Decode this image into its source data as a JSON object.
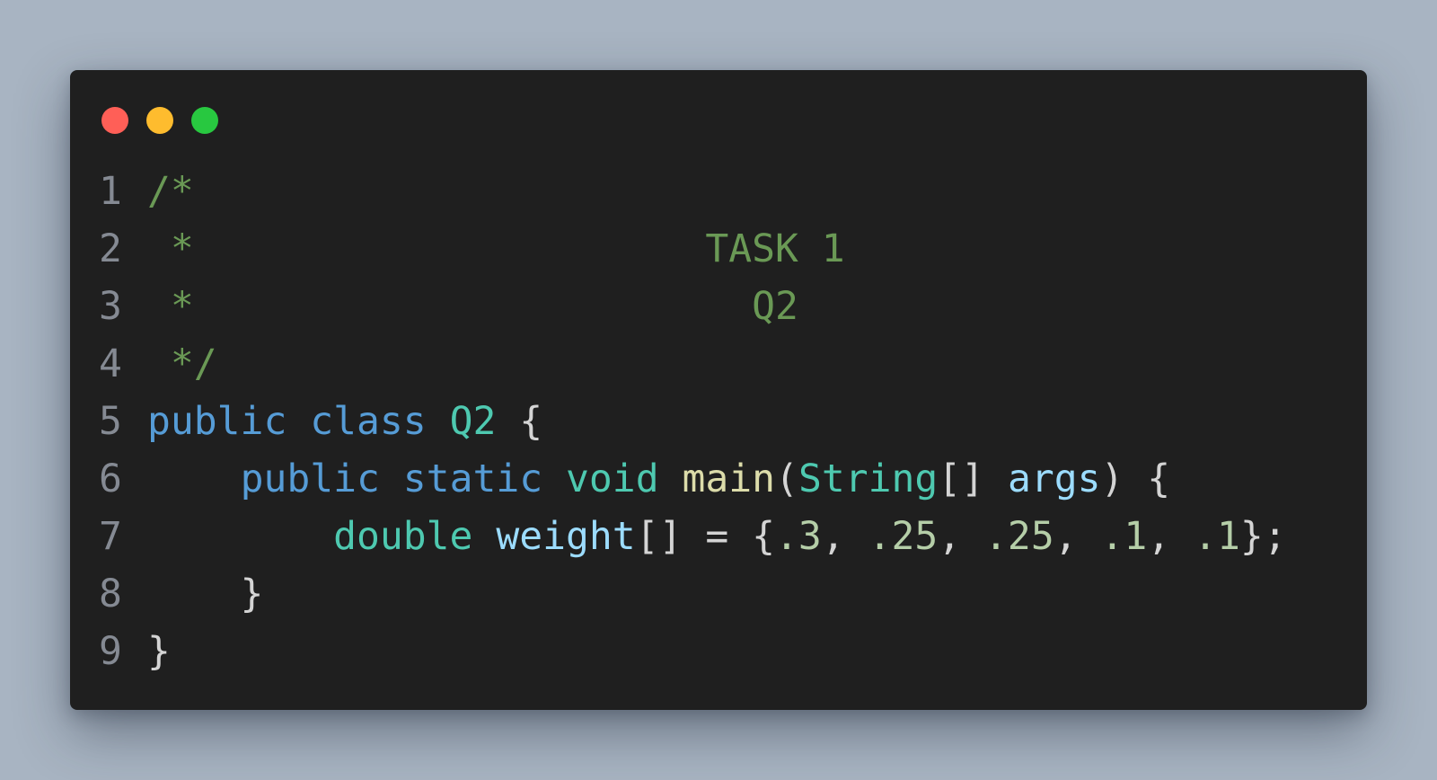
{
  "colors": {
    "background": "#a8b4c2",
    "window": "#1f1f1f",
    "close_dot": "#ff5f57",
    "minimize_dot": "#febc2e",
    "maximize_dot": "#28c840",
    "line_number": "#858a93",
    "comment": "#6a9955",
    "keyword": "#569cd6",
    "type": "#4ec9b0",
    "function": "#dcdcaa",
    "variable": "#9cdcfe",
    "number": "#b5cea8",
    "punctuation": "#d4d4d4"
  },
  "window_controls": [
    {
      "name": "close-dot-icon",
      "color": "#ff5f57"
    },
    {
      "name": "minimize-dot-icon",
      "color": "#febc2e"
    },
    {
      "name": "maximize-dot-icon",
      "color": "#28c840"
    }
  ],
  "code": {
    "lines": [
      {
        "number": "1",
        "tokens": [
          {
            "text": "/*",
            "kind": "comment"
          }
        ]
      },
      {
        "number": "2",
        "tokens": [
          {
            "text": " *                      TASK 1",
            "kind": "comment"
          }
        ]
      },
      {
        "number": "3",
        "tokens": [
          {
            "text": " *                        Q2",
            "kind": "comment"
          }
        ]
      },
      {
        "number": "4",
        "tokens": [
          {
            "text": " */",
            "kind": "comment"
          }
        ]
      },
      {
        "number": "5",
        "tokens": [
          {
            "text": "public",
            "kind": "keyword"
          },
          {
            "text": " ",
            "kind": "punctuation"
          },
          {
            "text": "class",
            "kind": "keyword"
          },
          {
            "text": " ",
            "kind": "punctuation"
          },
          {
            "text": "Q2",
            "kind": "type"
          },
          {
            "text": " {",
            "kind": "punctuation"
          }
        ]
      },
      {
        "number": "6",
        "tokens": [
          {
            "text": "    ",
            "kind": "punctuation"
          },
          {
            "text": "public",
            "kind": "keyword"
          },
          {
            "text": " ",
            "kind": "punctuation"
          },
          {
            "text": "static",
            "kind": "keyword"
          },
          {
            "text": " ",
            "kind": "punctuation"
          },
          {
            "text": "void",
            "kind": "type"
          },
          {
            "text": " ",
            "kind": "punctuation"
          },
          {
            "text": "main",
            "kind": "function"
          },
          {
            "text": "(",
            "kind": "punctuation"
          },
          {
            "text": "String",
            "kind": "type"
          },
          {
            "text": "[] ",
            "kind": "punctuation"
          },
          {
            "text": "args",
            "kind": "variable"
          },
          {
            "text": ") {",
            "kind": "punctuation"
          }
        ]
      },
      {
        "number": "7",
        "tokens": [
          {
            "text": "        ",
            "kind": "punctuation"
          },
          {
            "text": "double",
            "kind": "type"
          },
          {
            "text": " ",
            "kind": "punctuation"
          },
          {
            "text": "weight",
            "kind": "variable"
          },
          {
            "text": "[] = {",
            "kind": "punctuation"
          },
          {
            "text": ".3",
            "kind": "number"
          },
          {
            "text": ", ",
            "kind": "punctuation"
          },
          {
            "text": ".25",
            "kind": "number"
          },
          {
            "text": ", ",
            "kind": "punctuation"
          },
          {
            "text": ".25",
            "kind": "number"
          },
          {
            "text": ", ",
            "kind": "punctuation"
          },
          {
            "text": ".1",
            "kind": "number"
          },
          {
            "text": ", ",
            "kind": "punctuation"
          },
          {
            "text": ".1",
            "kind": "number"
          },
          {
            "text": "};",
            "kind": "punctuation"
          }
        ]
      },
      {
        "number": "8",
        "tokens": [
          {
            "text": "    }",
            "kind": "punctuation"
          }
        ]
      },
      {
        "number": "9",
        "tokens": [
          {
            "text": "}",
            "kind": "punctuation"
          }
        ]
      }
    ]
  }
}
